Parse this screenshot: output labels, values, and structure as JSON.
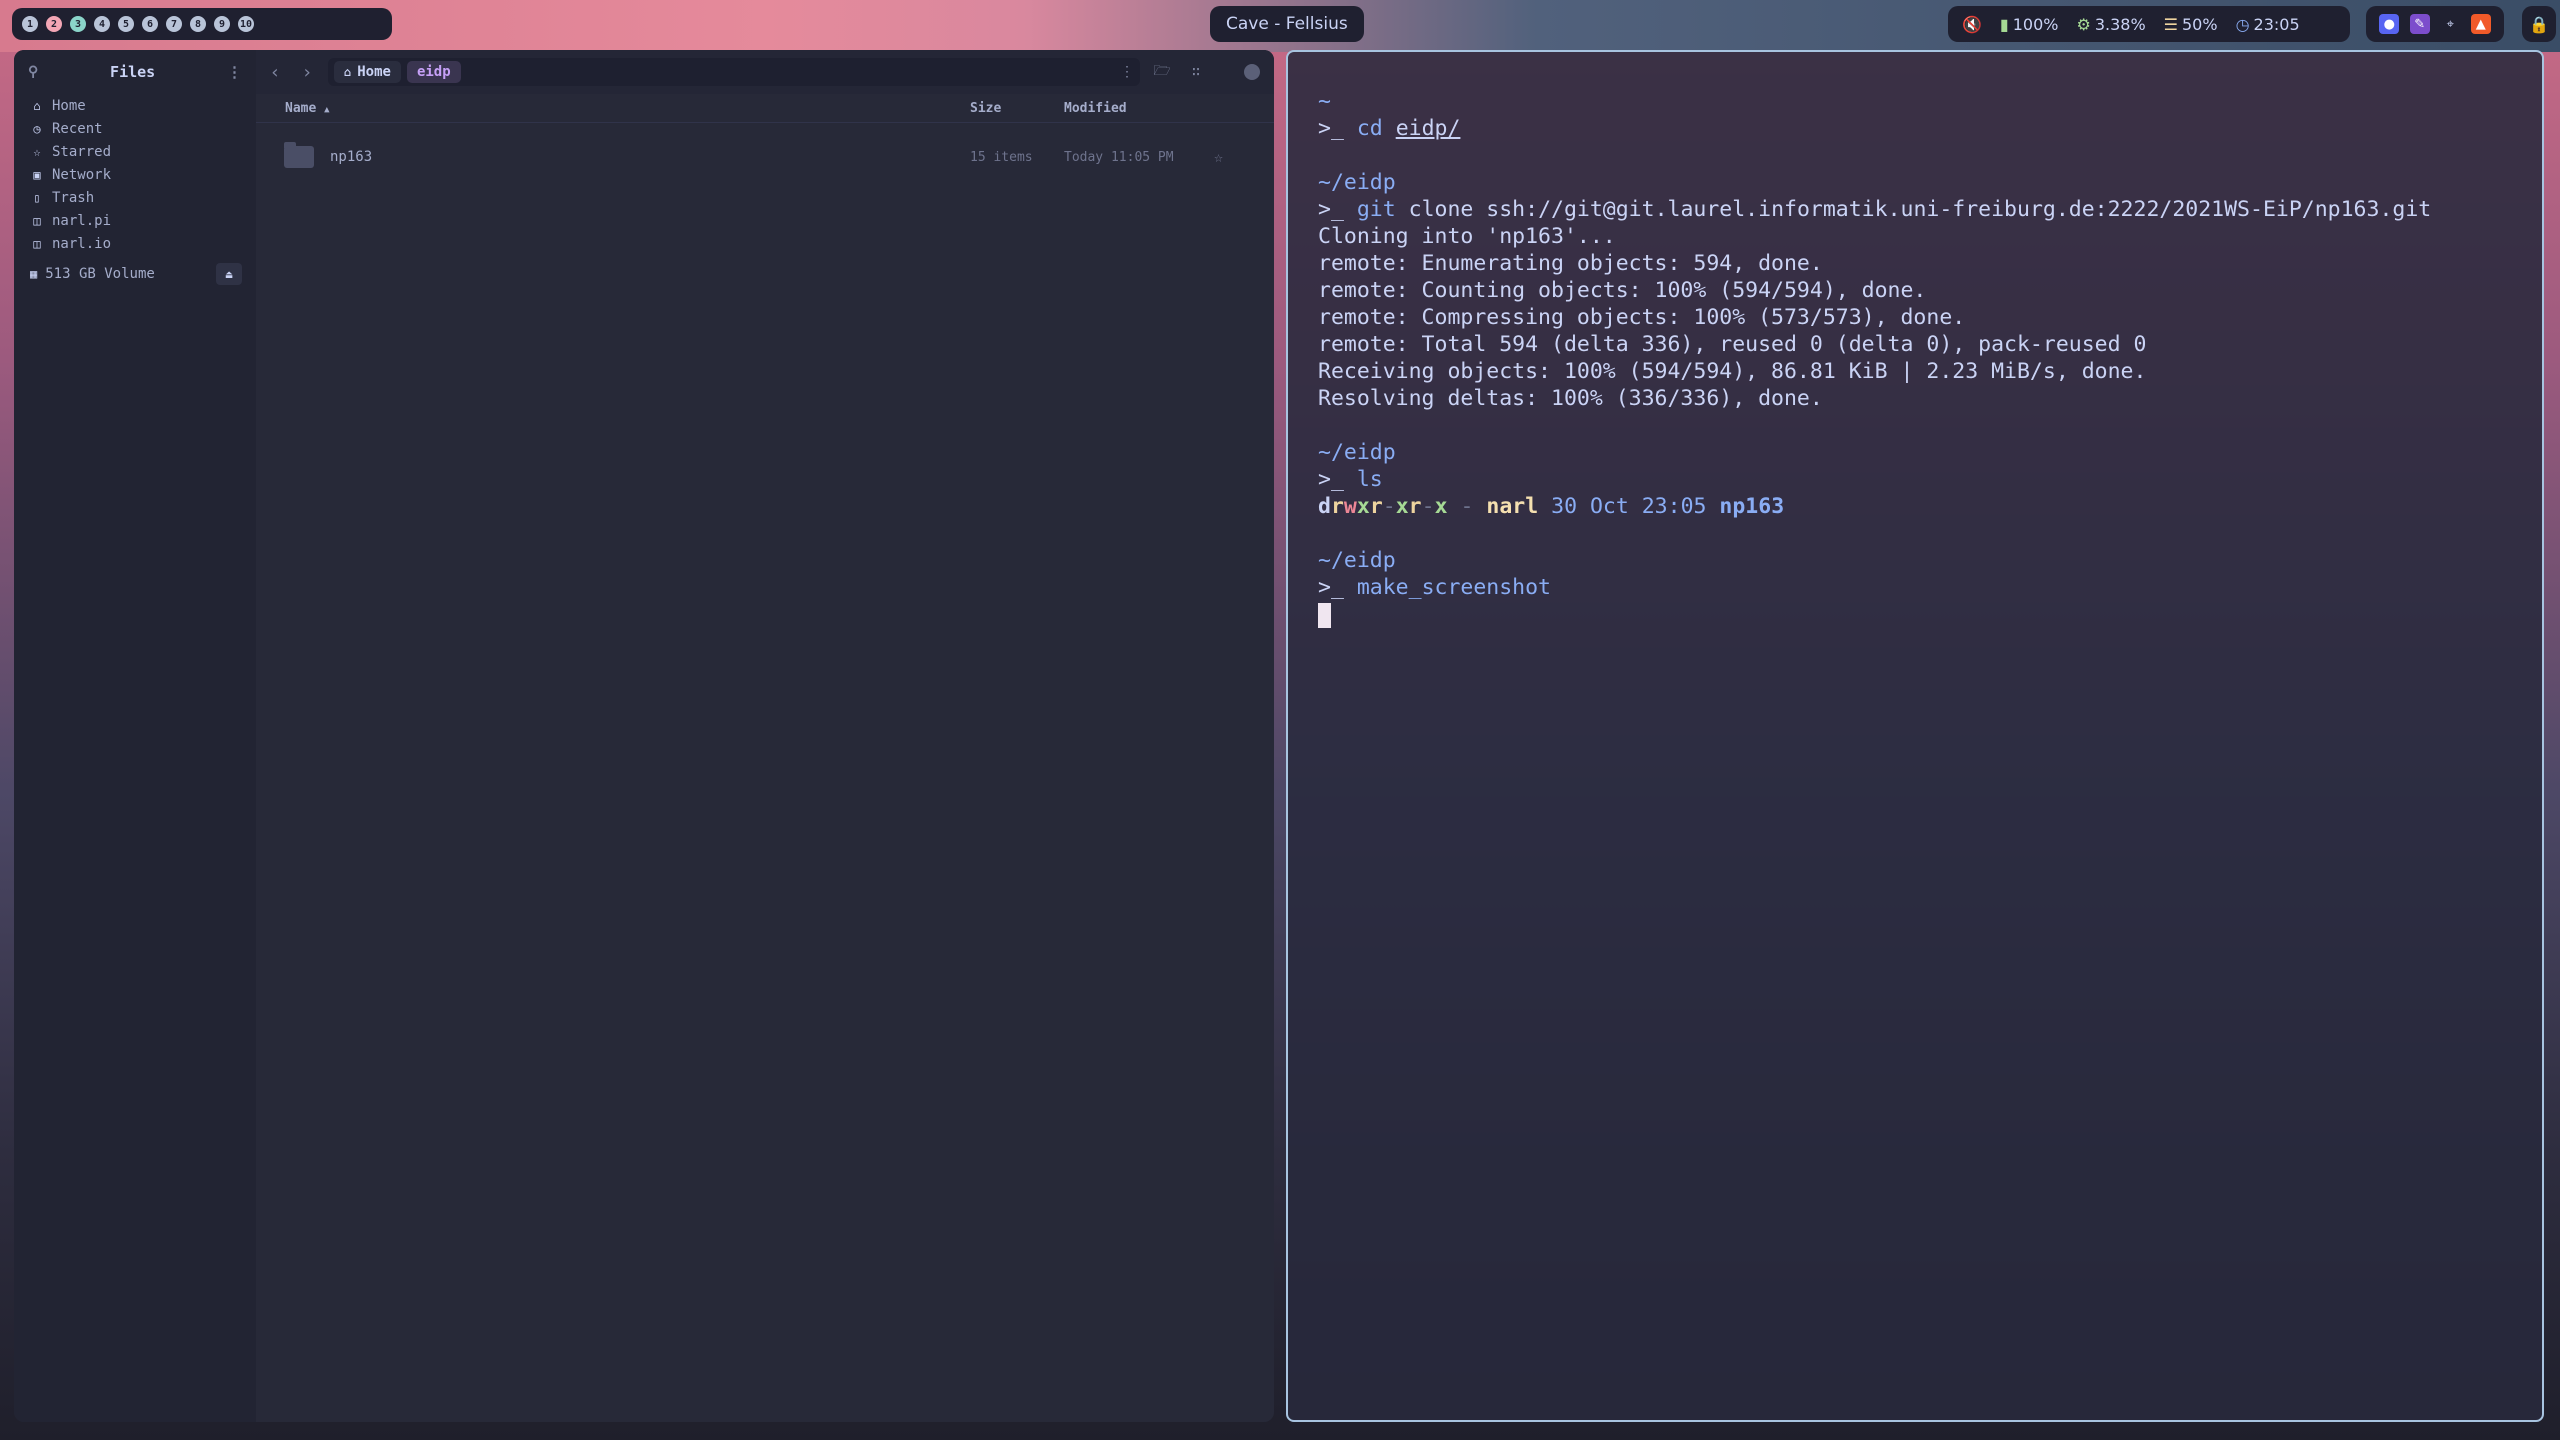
{
  "topbar": {
    "workspaces": [
      "1",
      "2",
      "3",
      "4",
      "5",
      "6",
      "7",
      "8",
      "9",
      "10"
    ],
    "window_title": "Cave - Fellsius",
    "status": {
      "volume_icon": "muted-speaker-icon",
      "battery": "100%",
      "cpu": "3.38%",
      "memory": "50%",
      "clock": "23:05"
    },
    "apps": [
      "discord-icon",
      "notes-icon",
      "wifi-icon",
      "brave-icon"
    ]
  },
  "files": {
    "title": "Files",
    "sidebar": {
      "items": [
        {
          "label": "Home",
          "icon": "home-icon"
        },
        {
          "label": "Recent",
          "icon": "clock-icon"
        },
        {
          "label": "Starred",
          "icon": "star-icon"
        },
        {
          "label": "Network",
          "icon": "network-icon"
        },
        {
          "label": "Trash",
          "icon": "trash-icon"
        },
        {
          "label": "narl.pi",
          "icon": "remote-folder-icon"
        },
        {
          "label": "narl.io",
          "icon": "remote-folder-icon"
        }
      ],
      "volume": "513 GB Volume"
    },
    "path": [
      "Home",
      "eidp"
    ],
    "columns": {
      "name": "Name",
      "size": "Size",
      "modified": "Modified"
    },
    "rows": [
      {
        "name": "np163",
        "size": "15 items",
        "modified": "Today 11:05 PM"
      }
    ]
  },
  "terminal": {
    "lines": {
      "l1": "~",
      "l2_prompt": ">_ ",
      "l2_cmd": "cd",
      "l2_arg": "eidp/",
      "l4": "~/eidp",
      "l5_prompt": ">_ ",
      "l5_cmd": "git",
      "l5_rest": " clone ssh://git@git.laurel.informatik.uni-freiburg.de:2222/2021WS-EiP/np163.git",
      "l6": "Cloning into 'np163'...",
      "l7": "remote: Enumerating objects: 594, done.",
      "l8": "remote: Counting objects: 100% (594/594), done.",
      "l9": "remote: Compressing objects: 100% (573/573), done.",
      "l10": "remote: Total 594 (delta 336), reused 0 (delta 0), pack-reused 0",
      "l11": "Receiving objects: 100% (594/594), 86.81 KiB | 2.23 MiB/s, done.",
      "l12": "Resolving deltas: 100% (336/336), done.",
      "l14": "~/eidp",
      "l15_prompt": ">_ ",
      "l15_cmd": "ls",
      "ls_user": "narl",
      "ls_date": "30 Oct 23:05",
      "ls_name": "np163",
      "l18": "~/eidp",
      "l19_prompt": ">_ ",
      "l19_cmd": "make_screenshot"
    }
  }
}
